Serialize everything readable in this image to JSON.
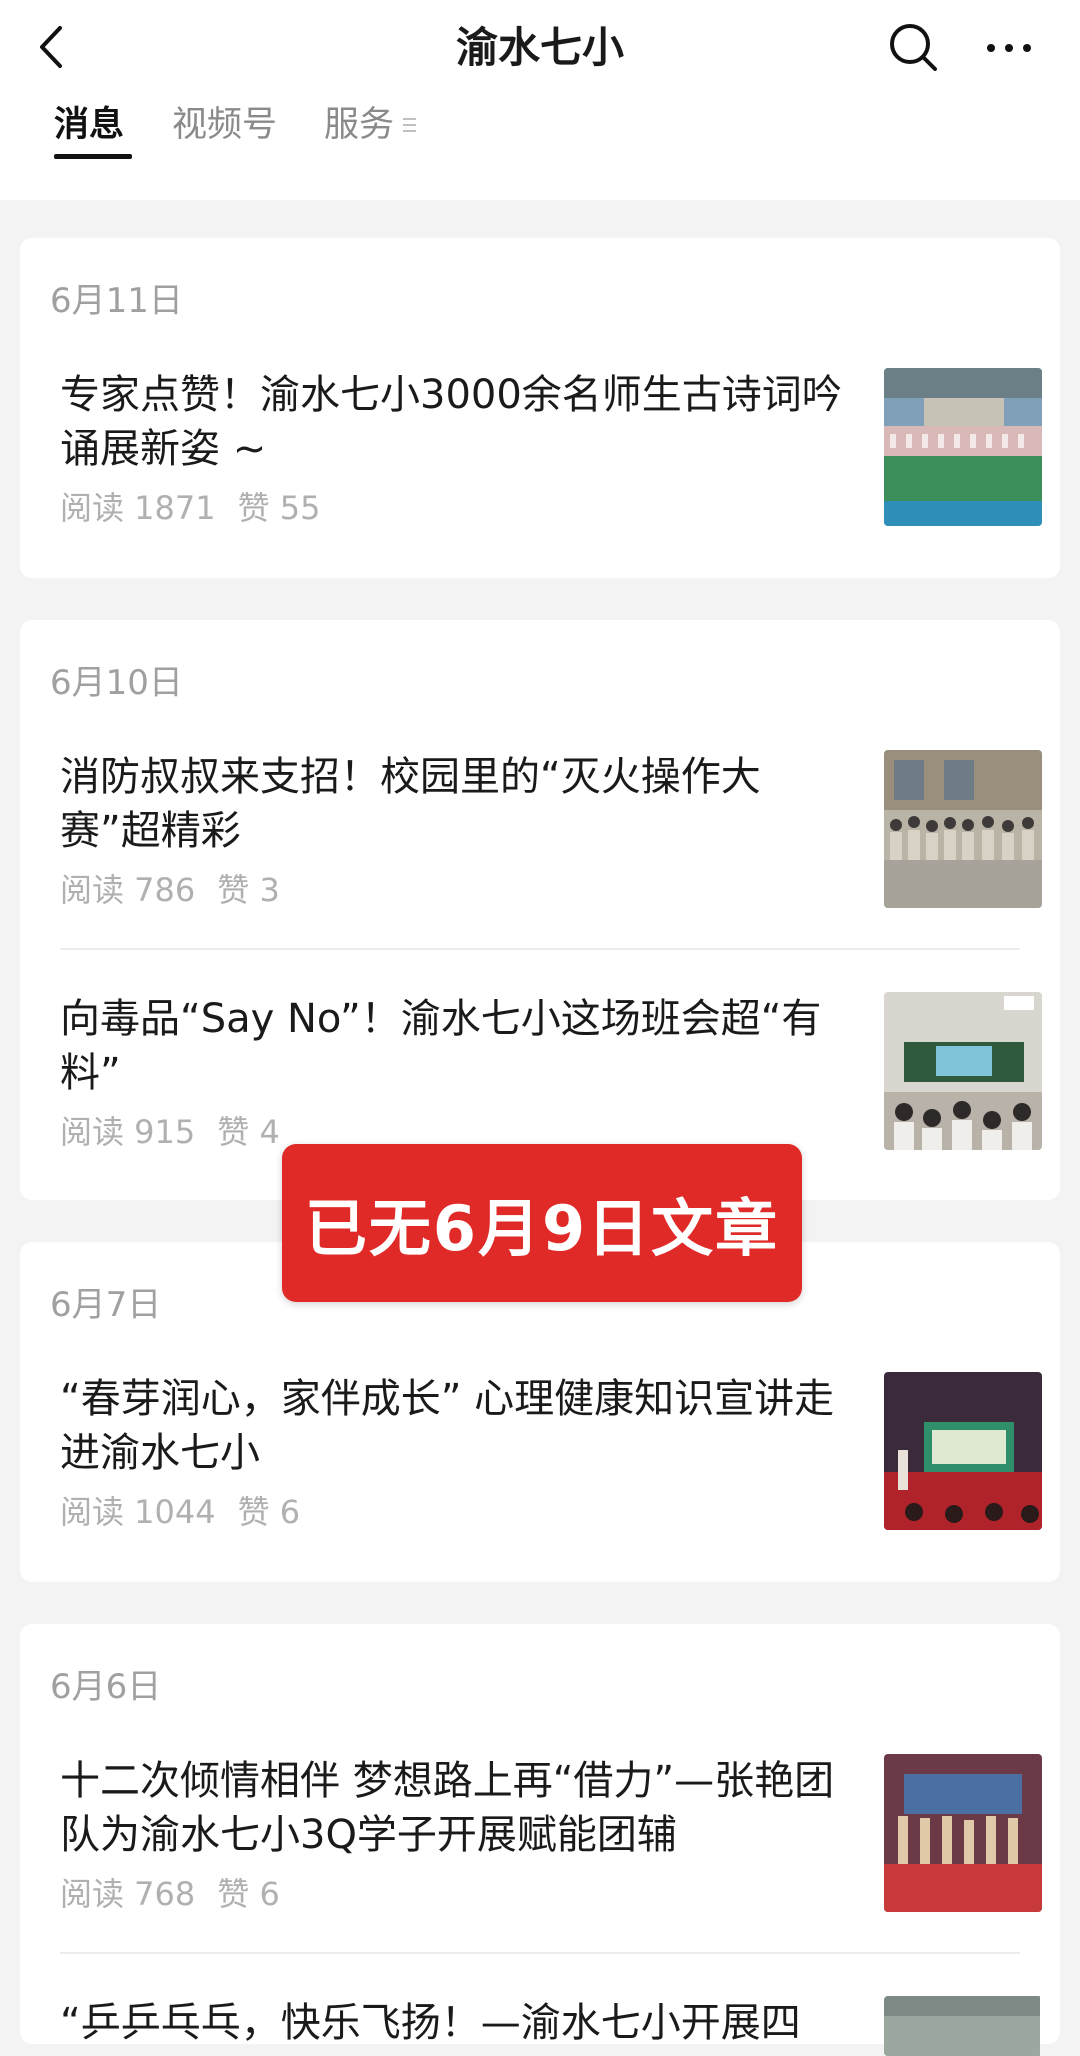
{
  "header": {
    "title": "渝水七小",
    "back_icon": "chevron-left-icon",
    "search_icon": "search-icon",
    "more_icon": "more-dots-icon"
  },
  "tabs": [
    {
      "label": "消息",
      "active": true
    },
    {
      "label": "视频号",
      "active": false
    },
    {
      "label": "服务",
      "active": false
    }
  ],
  "groups": [
    {
      "date": "6月11日",
      "articles": [
        {
          "title": "专家点赞！渝水七小3000余名师生古诗词吟诵展新姿 ~",
          "reads": "阅读 1871",
          "likes": "赞 55"
        }
      ]
    },
    {
      "date": "6月10日",
      "articles": [
        {
          "title": "消防叔叔来支招！校园里的“灭火操作大赛”超精彩",
          "reads": "阅读 786",
          "likes": "赞 3"
        },
        {
          "title": "向毒品“Say No”！渝水七小这场班会超“有料”",
          "reads": "阅读 915",
          "likes": "赞 4"
        }
      ]
    },
    {
      "date": "6月7日",
      "articles": [
        {
          "title": "“春芽润心，家伴成长” 心理健康知识宣讲走进渝水七小",
          "reads": "阅读 1044",
          "likes": "赞 6"
        }
      ]
    },
    {
      "date": "6月6日",
      "articles": [
        {
          "title": "十二次倾情相伴 梦想路上再“借力”—张艳团队为渝水七小3Q学子开展赋能团辅",
          "reads": "阅读 768",
          "likes": "赞 6"
        },
        {
          "title": "“乒乒乓乓，快乐飞扬！—渝水七小开展四",
          "reads": "",
          "likes": ""
        }
      ]
    }
  ],
  "toast": {
    "text": "已无6月9日文章",
    "color": "#e02a27"
  }
}
